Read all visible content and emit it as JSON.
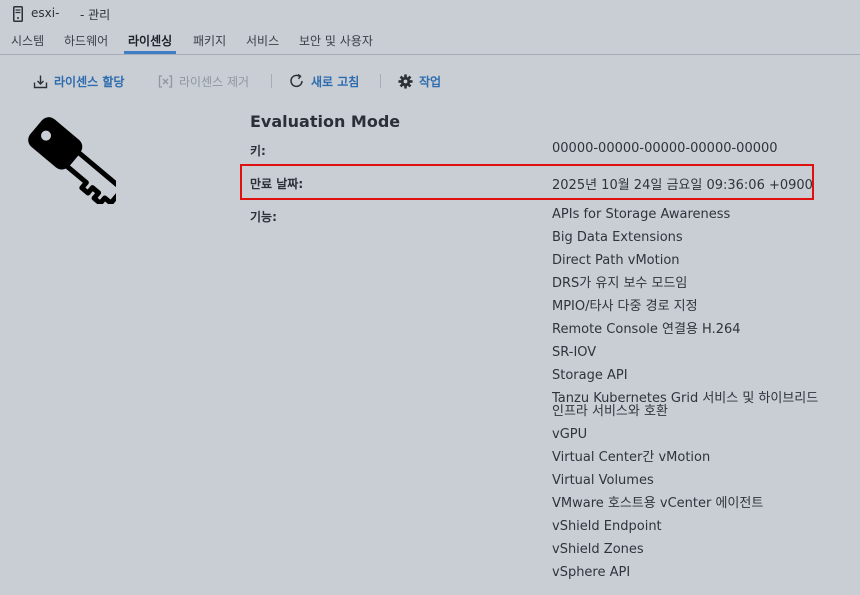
{
  "window": {
    "host_name": "esxi-",
    "title_suffix": "- 관리"
  },
  "tabs": [
    {
      "label": "시스템",
      "active": false
    },
    {
      "label": "하드웨어",
      "active": false
    },
    {
      "label": "라이센싱",
      "active": true
    },
    {
      "label": "패키지",
      "active": false
    },
    {
      "label": "서비스",
      "active": false
    },
    {
      "label": "보안 및 사용자",
      "active": false
    }
  ],
  "toolbar": {
    "assign_license": "라이센스 할당",
    "remove_license": "라이센스 제거",
    "refresh": "새로 고침",
    "actions": "작업"
  },
  "license": {
    "mode": "Evaluation Mode",
    "key_label": "키:",
    "key_value": "00000-00000-00000-00000-00000",
    "expiry_label": "만료 날짜:",
    "expiry_value": "2025년 10월 24일 금요일 09:36:06 +0900",
    "features_label": "기능:",
    "features": [
      "APIs for Storage Awareness",
      "Big Data Extensions",
      "Direct Path vMotion",
      "DRS가 유지 보수 모드임",
      "MPIO/타사 다중 경로 지정",
      "Remote Console 연결용 H.264",
      "SR-IOV",
      "Storage API",
      "Tanzu Kubernetes Grid 서비스 및 하이브리드 인프라 서비스와 호환",
      "vGPU",
      "Virtual Center간 vMotion",
      "Virtual Volumes",
      "VMware 호스트용 vCenter 에이전트",
      "vShield Endpoint",
      "vShield Zones",
      "vSphere API"
    ]
  },
  "colors": {
    "background": "#c9ced5",
    "link_blue": "#2e6cae",
    "tab_underline": "#3f7ec4",
    "highlight_red": "#e01010"
  }
}
